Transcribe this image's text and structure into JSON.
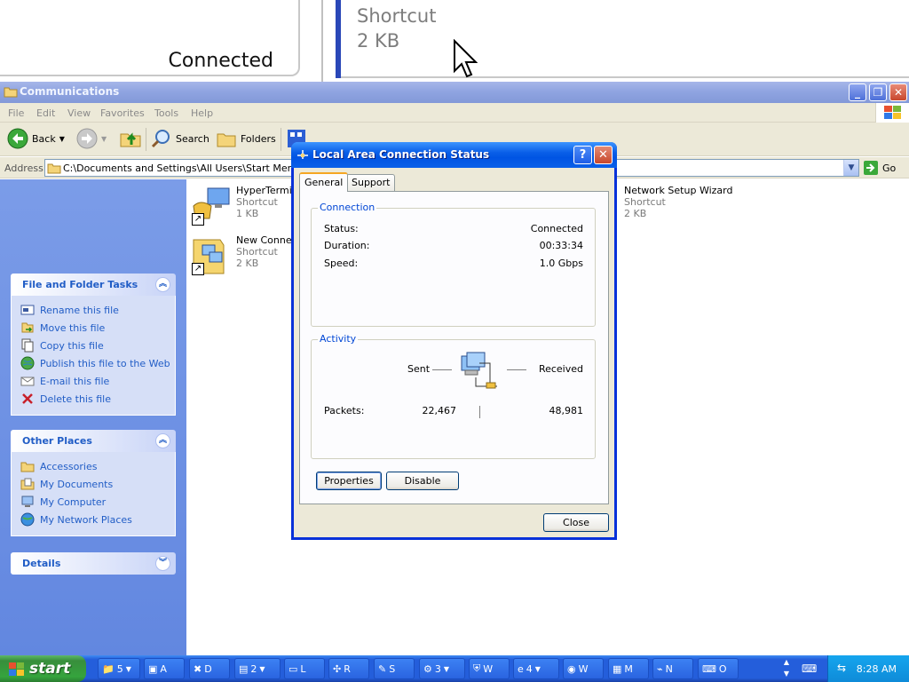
{
  "zoom": {
    "left_text": "Connected",
    "right_line1": "Shortcut",
    "right_line2": "2 KB"
  },
  "window": {
    "title": "Communications",
    "menu": [
      "File",
      "Edit",
      "View",
      "Favorites",
      "Tools",
      "Help"
    ],
    "toolbar": {
      "back": "Back",
      "search": "Search",
      "folders": "Folders"
    },
    "address": {
      "label": "Address",
      "path": "C:\\Documents and Settings\\All Users\\Start Menu\\Prog",
      "go": "Go"
    }
  },
  "taskpane": {
    "file_tasks": {
      "title": "File and Folder Tasks",
      "items": [
        "Rename this file",
        "Move this file",
        "Copy this file",
        "Publish this file to the Web",
        "E-mail this file",
        "Delete this file"
      ]
    },
    "other_places": {
      "title": "Other Places",
      "items": [
        "Accessories",
        "My Documents",
        "My Computer",
        "My Network Places"
      ]
    },
    "details": {
      "title": "Details"
    }
  },
  "files": [
    {
      "name": "HyperTerminal",
      "type": "Shortcut",
      "size": "1 KB"
    },
    {
      "name": "New Connection Wizard",
      "type": "Shortcut",
      "size": "2 KB"
    },
    {
      "name": "Network Setup Wizard",
      "type": "Shortcut",
      "size": "2 KB"
    }
  ],
  "dialog": {
    "title": "Local Area Connection Status",
    "tabs": [
      "General",
      "Support"
    ],
    "connection": {
      "label": "Connection",
      "status_label": "Status:",
      "status": "Connected",
      "duration_label": "Duration:",
      "duration": "00:33:34",
      "speed_label": "Speed:",
      "speed": "1.0 Gbps"
    },
    "activity": {
      "label": "Activity",
      "sent_label": "Sent",
      "received_label": "Received",
      "packets_label": "Packets:",
      "sent_packets": "22,467",
      "received_packets": "48,981"
    },
    "buttons": {
      "properties": "Properties",
      "disable": "Disable",
      "close": "Close"
    }
  },
  "taskbar": {
    "start": "start",
    "buttons": [
      {
        "label": "5",
        "icon": "folder-icon"
      },
      {
        "label": "A",
        "icon": "app-icon"
      },
      {
        "label": "D",
        "icon": "tools-icon"
      },
      {
        "label": "2",
        "icon": "config-icon"
      },
      {
        "label": "L",
        "icon": "window-icon"
      },
      {
        "label": "R",
        "icon": "network-icon"
      },
      {
        "label": "S",
        "icon": "setup-icon"
      },
      {
        "label": "3",
        "icon": "gear-icon"
      },
      {
        "label": "W",
        "icon": "shield-icon"
      },
      {
        "label": "4",
        "icon": "ie-icon"
      },
      {
        "label": "W",
        "icon": "media-icon"
      },
      {
        "label": "M",
        "icon": "monitor-icon"
      },
      {
        "label": "N",
        "icon": "network-icon"
      },
      {
        "label": "O",
        "icon": "keyboard-icon"
      }
    ],
    "clock": "8:28 AM"
  }
}
